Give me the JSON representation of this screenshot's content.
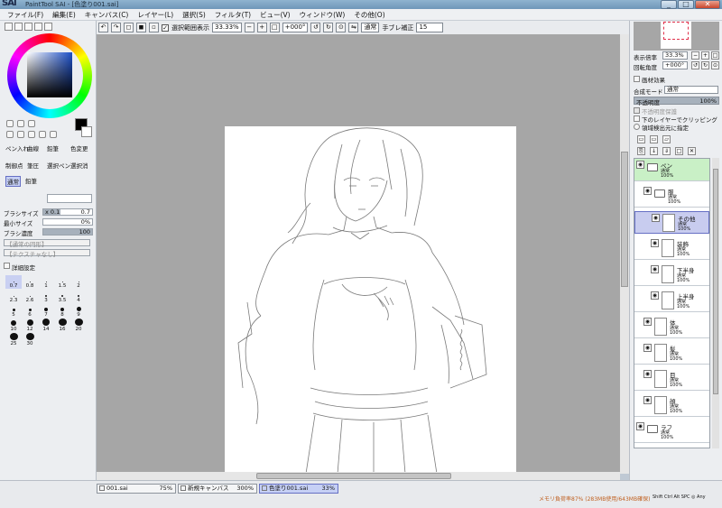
{
  "app": {
    "logo": "SAI",
    "title": "PaintTool SAI - [色塗り001.sai]",
    "window_buttons": [
      "_",
      "□",
      "✕"
    ]
  },
  "menu": [
    "ファイル(F)",
    "編集(E)",
    "キャンバス(C)",
    "レイヤー(L)",
    "選択(S)",
    "フィルタ(T)",
    "ビュー(V)",
    "ウィンドウ(W)",
    "その他(O)"
  ],
  "toolbar": {
    "show_selection_label": "選択範囲表示",
    "zoom": "33.33%",
    "angle": "+000°",
    "blend": "通常",
    "stabilizer_label": "手ブレ補正",
    "stabilizer_value": "15"
  },
  "left_panel": {
    "tools_row1": [
      "ペン入れ",
      "曲線",
      "鉛筆",
      "色変更"
    ],
    "tools_row2": [
      "制御点",
      "筆圧",
      "選択ペン",
      "選択消"
    ],
    "tab_normal": "通常",
    "tab_pen": "鉛筆",
    "brush_size_label": "ブラシサイズ",
    "brush_size_mult": "x 0.1",
    "brush_size_value": "0.7",
    "brush_size_fraction": 0.35,
    "min_size_label": "最小サイズ",
    "min_size_value": "0%",
    "density_label": "ブラシ濃度",
    "density_value": "100",
    "density_fraction": 1.0,
    "shape1": "【通常の円形】",
    "shape2": "【テクスチャなし】",
    "detail_label": "詳細設定",
    "sizes": [
      "0.7",
      "0.8",
      "1",
      "1.5",
      "2",
      "2.3",
      "2.6",
      "3",
      "3.5",
      "4",
      "5",
      "6",
      "7",
      "8",
      "9",
      "10",
      "12",
      "14",
      "16",
      "20",
      "25",
      "30"
    ]
  },
  "right_panel": {
    "zoom_label": "表示倍率",
    "zoom_value": "33.3%",
    "angle_label": "回転角度",
    "angle_value": "+000°",
    "effects_label": "画材効果",
    "blend_label": "合成モード",
    "blend_value": "通常",
    "opacity_label": "不透明度",
    "opacity_value": "100%",
    "opt1": "不透明度保護",
    "opt2": "下のレイヤーでクリッピング",
    "opt3": "領域検出元に指定"
  },
  "layers": [
    {
      "name": "ペン",
      "mode": "通常",
      "opacity": "100%",
      "type": "folder",
      "level": 0,
      "state": "green"
    },
    {
      "name": "服",
      "mode": "通常",
      "opacity": "100%",
      "type": "folder",
      "level": 1,
      "state": ""
    },
    {
      "name": "その他",
      "mode": "通常",
      "opacity": "100%",
      "type": "layer",
      "level": 2,
      "state": "blue"
    },
    {
      "name": "装飾",
      "mode": "通常",
      "opacity": "100%",
      "type": "layer",
      "level": 2,
      "state": ""
    },
    {
      "name": "下半身",
      "mode": "通常",
      "opacity": "100%",
      "type": "layer",
      "level": 2,
      "state": ""
    },
    {
      "name": "上半身",
      "mode": "通常",
      "opacity": "100%",
      "type": "layer",
      "level": 2,
      "state": ""
    },
    {
      "name": "体",
      "mode": "通常",
      "opacity": "100%",
      "type": "layer",
      "level": 1,
      "state": ""
    },
    {
      "name": "髪",
      "mode": "通常",
      "opacity": "100%",
      "type": "layer",
      "level": 1,
      "state": ""
    },
    {
      "name": "目",
      "mode": "通常",
      "opacity": "100%",
      "type": "layer",
      "level": 1,
      "state": ""
    },
    {
      "name": "顔",
      "mode": "通常",
      "opacity": "100%",
      "type": "layer",
      "level": 1,
      "state": ""
    },
    {
      "name": "ラフ",
      "mode": "通常",
      "opacity": "100%",
      "type": "folder",
      "level": 0,
      "state": ""
    }
  ],
  "docs": [
    {
      "name": "001.sai",
      "zoom": "75%"
    },
    {
      "name": "新規キャンバス",
      "zoom": "300%"
    },
    {
      "name": "色塗り001.sai",
      "zoom": "33%"
    }
  ],
  "status": {
    "memory": "メモリ負荷率87% (283MB使用/643MB確保)",
    "keys": "Shift Ctrl Alt SPC ◎ Any"
  }
}
